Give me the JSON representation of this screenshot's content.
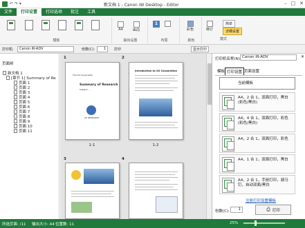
{
  "title_bar": {
    "quick_access": "↶ ↷ ▾",
    "title": "新文档 1 - Canon iW Desktop - Editor",
    "buttons": [
      "–",
      "□",
      "✕"
    ]
  },
  "menu": {
    "items": [
      "文件",
      "打印设置",
      "打印选项",
      "批注",
      "工具"
    ],
    "active_index": 1
  },
  "ribbon": {
    "groups": [
      "模板",
      "输出设置",
      "布局",
      "颜色",
      "模式"
    ],
    "buttons": {
      "template_1": "",
      "size": "A4",
      "orientation": "纵向",
      "layout": "1",
      "color": "彩色",
      "mode_booklet": "绑订"
    },
    "toggles": {
      "simple": "简单",
      "detail": "详细设置"
    }
  },
  "toolbar": {
    "printer_label": "打印机:",
    "printer_value": "Canon iR-ADV",
    "copies_label": "份数(C):",
    "copies_value": "1",
    "print_label": "打印",
    "show_print": "显示打印"
  },
  "left_panel": {
    "title": "页面树",
    "items": [
      {
        "label": "新文档 1",
        "level": 0
      },
      {
        "label": "[章节 1] Summary of Re",
        "level": 1
      },
      {
        "label": "页面 1",
        "level": 2
      },
      {
        "label": "页面 2",
        "level": 2
      },
      {
        "label": "页面 3",
        "level": 2
      },
      {
        "label": "页面 4",
        "level": 2
      },
      {
        "label": "页面 5",
        "level": 2
      },
      {
        "label": "页面 6",
        "level": 2
      },
      {
        "label": "页面 7",
        "level": 2
      },
      {
        "label": "页面 8",
        "level": 2
      },
      {
        "label": "页面 9",
        "level": 2
      },
      {
        "label": "页面 10",
        "level": 2
      },
      {
        "label": "页面 11",
        "level": 2
      }
    ]
  },
  "pages": [
    {
      "num": "1",
      "label": "1-1",
      "org": "The XX Corporation",
      "heading": "Summary of Research",
      "sub": "Subject: ...",
      "logo_text": "XX RESEARCH"
    },
    {
      "num": "2",
      "label": "1-2",
      "heading": "Introduction to XX Corporation"
    },
    {
      "num": "3",
      "label": ""
    },
    {
      "num": "4",
      "label": ""
    }
  ],
  "right_panel": {
    "printer_label": "打印机名称(N):",
    "printer_value": "Canon iR-ADV",
    "tabs": [
      "模板",
      "打印设置",
      "页面设置"
    ],
    "selected_tab": 1,
    "settings": [
      "当前模板",
      "A4，2 合 1，双面打印，黑白 (彩色/黑白)",
      "A4，4 合 1，双面打印，彩色 (彩色/黑白)",
      "A4，2 合 1，双面打印，彩色",
      "A4，1 合 1，双面打印，黑白",
      "A4，2 合 1，手册打印，骑马钉，自动双面/黑白"
    ],
    "register_link": "注册打印设置模板",
    "copies_label": "份数(C):",
    "copies_value": "1",
    "print_button": "打印"
  },
  "status_bar": {
    "pages": "所选页面: /11",
    "paper": "输出大小: A4",
    "pos": "位置数: 11",
    "zoom": "25%"
  }
}
